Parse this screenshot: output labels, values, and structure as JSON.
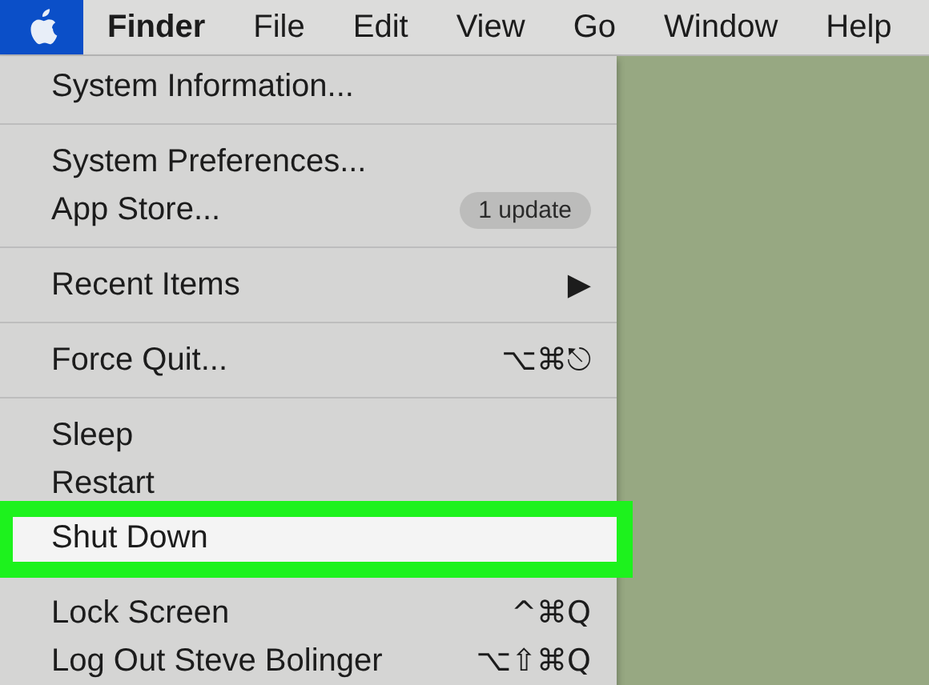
{
  "menu_bar": {
    "apple_menu_open": true,
    "items": [
      {
        "label": "Finder",
        "bold": true
      },
      {
        "label": "File",
        "bold": false
      },
      {
        "label": "Edit",
        "bold": false
      },
      {
        "label": "View",
        "bold": false
      },
      {
        "label": "Go",
        "bold": false
      },
      {
        "label": "Window",
        "bold": false
      },
      {
        "label": "Help",
        "bold": false
      }
    ]
  },
  "apple_menu": {
    "items": [
      {
        "kind": "item",
        "label": "System Information...",
        "selected": false
      },
      {
        "kind": "separator"
      },
      {
        "kind": "item",
        "label": "System Preferences...",
        "selected": false
      },
      {
        "kind": "item",
        "label": "App Store...",
        "badge": "1 update",
        "selected": false
      },
      {
        "kind": "separator"
      },
      {
        "kind": "item",
        "label": "Recent Items",
        "submenu": "▶",
        "selected": false
      },
      {
        "kind": "separator"
      },
      {
        "kind": "item",
        "label": "Force Quit...",
        "shortcut": "⌥⌘⎋",
        "selected": false
      },
      {
        "kind": "separator"
      },
      {
        "kind": "item",
        "label": "Sleep",
        "selected": false
      },
      {
        "kind": "item",
        "label": "Restart",
        "selected": false
      },
      {
        "kind": "item",
        "label": "Shut Down",
        "selected": true,
        "annotated": true
      },
      {
        "kind": "separator"
      },
      {
        "kind": "item",
        "label": "Lock Screen",
        "shortcut": "^⌘Q",
        "selected": false
      },
      {
        "kind": "item",
        "label": "Log Out Steve Bolinger",
        "shortcut": "⌥⇧⌘Q",
        "selected": false
      }
    ]
  }
}
